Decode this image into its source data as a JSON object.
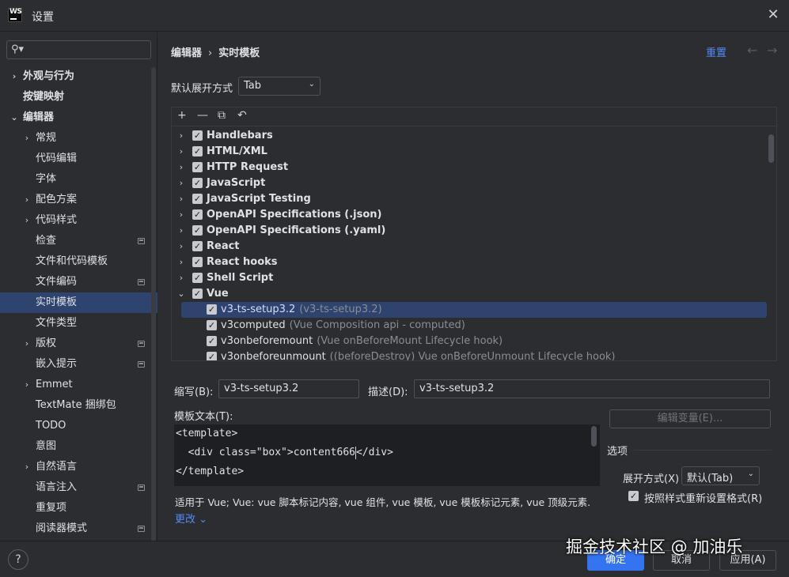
{
  "window": {
    "title": "设置",
    "logo_text": "WS"
  },
  "sidebar": {
    "items": [
      {
        "label": "外观与行为",
        "bold": true,
        "chevron": "›",
        "level": 0
      },
      {
        "label": "按键映射",
        "bold": true,
        "chevron": "",
        "level": 0
      },
      {
        "label": "编辑器",
        "bold": true,
        "chevron": "⌄",
        "level": 0
      },
      {
        "label": "常规",
        "chevron": "›",
        "level": 1
      },
      {
        "label": "代码编辑",
        "chevron": "",
        "level": 1
      },
      {
        "label": "字体",
        "chevron": "",
        "level": 1
      },
      {
        "label": "配色方案",
        "chevron": "›",
        "level": 1
      },
      {
        "label": "代码样式",
        "chevron": "›",
        "level": 1
      },
      {
        "label": "检查",
        "chevron": "",
        "level": 1,
        "mark": true
      },
      {
        "label": "文件和代码模板",
        "chevron": "",
        "level": 1
      },
      {
        "label": "文件编码",
        "chevron": "",
        "level": 1,
        "mark": true
      },
      {
        "label": "实时模板",
        "chevron": "",
        "level": 1,
        "selected": true
      },
      {
        "label": "文件类型",
        "chevron": "",
        "level": 1
      },
      {
        "label": "版权",
        "chevron": "›",
        "level": 1,
        "mark": true
      },
      {
        "label": "嵌入提示",
        "chevron": "",
        "level": 1,
        "mark": true
      },
      {
        "label": "Emmet",
        "chevron": "›",
        "level": 1
      },
      {
        "label": "TextMate 捆绑包",
        "chevron": "",
        "level": 1
      },
      {
        "label": "TODO",
        "chevron": "",
        "level": 1
      },
      {
        "label": "意图",
        "chevron": "",
        "level": 1
      },
      {
        "label": "自然语言",
        "chevron": "›",
        "level": 1
      },
      {
        "label": "语言注入",
        "chevron": "",
        "level": 1,
        "mark": true
      },
      {
        "label": "重复项",
        "chevron": "",
        "level": 1
      },
      {
        "label": "阅读器模式",
        "chevron": "",
        "level": 1,
        "mark": true
      }
    ]
  },
  "header": {
    "breadcrumb": [
      "编辑器",
      "实时模板"
    ],
    "breadcrumb_sep": "›",
    "reset_label": "重置",
    "back_arrow": "←",
    "forward_arrow": "→"
  },
  "expand": {
    "label": "默认展开方式",
    "value": "Tab"
  },
  "toolbar": {
    "add": "+",
    "remove": "—",
    "copy": "⧉",
    "revert": "↶"
  },
  "template_groups": [
    {
      "name": "Handlebars",
      "checked": true
    },
    {
      "name": "HTML/XML",
      "checked": true
    },
    {
      "name": "HTTP Request",
      "checked": true
    },
    {
      "name": "JavaScript",
      "checked": true
    },
    {
      "name": "JavaScript Testing",
      "checked": true
    },
    {
      "name": "OpenAPI Specifications (.json)",
      "checked": true
    },
    {
      "name": "OpenAPI Specifications (.yaml)",
      "checked": true
    },
    {
      "name": "React",
      "checked": true
    },
    {
      "name": "React hooks",
      "checked": true
    },
    {
      "name": "Shell Script",
      "checked": true
    },
    {
      "name": "Vue",
      "checked": true,
      "expanded": true
    }
  ],
  "vue_templates": [
    {
      "abbr": "v3-ts-setup3.2",
      "desc": "(v3-ts-setup3.2)",
      "checked": true,
      "selected": true
    },
    {
      "abbr": "v3computed",
      "desc": "(Vue Composition api - computed)",
      "checked": true
    },
    {
      "abbr": "v3onbeforemount",
      "desc": "(Vue onBeforeMount Lifecycle hook)",
      "checked": true
    },
    {
      "abbr": "v3onbeforeunmount",
      "desc": "((beforeDestroy) Vue onBeforeUnmount Lifecycle hook)",
      "checked": true
    }
  ],
  "form": {
    "abbr_label": "缩写(B):",
    "abbr_value": "v3-ts-setup3.2",
    "desc_label": "描述(D):",
    "desc_value": "v3-ts-setup3.2",
    "template_text_label": "模板文本(T):",
    "edit_vars_label": "编辑变量(E)...",
    "template_lines": [
      "<template>",
      "  <div class=\"box\">content666",
      "</div>",
      "</template>"
    ]
  },
  "options": {
    "title": "选项",
    "expand_label": "展开方式(X)",
    "expand_value": "默认(Tab)",
    "reformat_label": "按照样式重新设置格式(R)",
    "reformat_checked": true
  },
  "applies": {
    "text": "适用于 Vue; Vue: vue 脚本标记内容, vue 组件, vue 模板, vue 模板标记元素, vue 顶级元素.",
    "change_label": "更改"
  },
  "footer": {
    "ok": "确定",
    "cancel": "取消",
    "apply": "应用(A)",
    "help": "?"
  },
  "watermark": "掘金技术社区 @ 加油乐",
  "colors": {
    "accent": "#3574f0",
    "selection": "#2e436e",
    "link": "#548af7",
    "background": "#2b2d30"
  }
}
